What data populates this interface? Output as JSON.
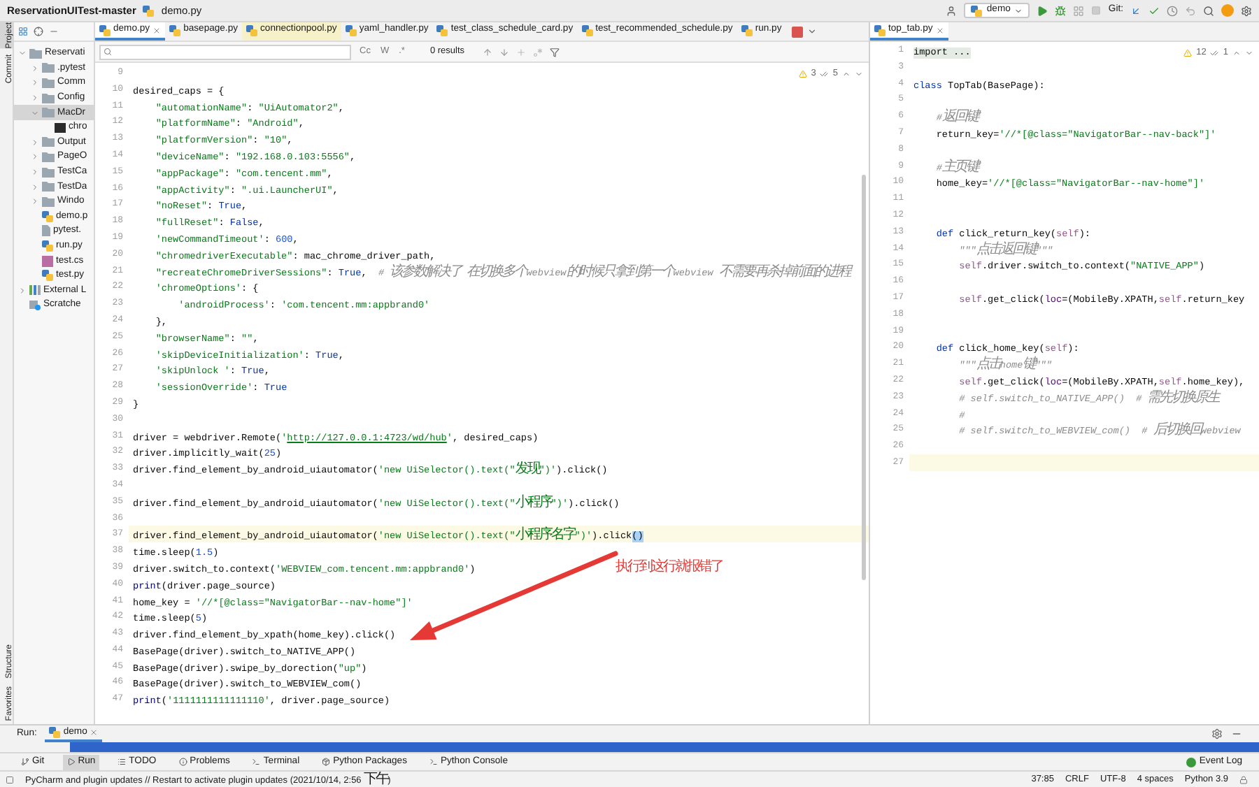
{
  "title_bar": {
    "project": "ReservationUITest-master",
    "file": "demo.py",
    "run_config": "demo",
    "vcs_label": "Git:"
  },
  "side_strip_top": [
    {
      "label": "Project",
      "selected": true
    },
    {
      "label": "Commit",
      "selected": false
    }
  ],
  "side_strip_bottom": [
    {
      "label": "Structure",
      "selected": false
    },
    {
      "label": "Favorites",
      "selected": false
    }
  ],
  "project_tree": [
    {
      "label": "Reservati",
      "kind": "folder",
      "expanded": true,
      "selected": false,
      "children": [
        {
          "label": ".pytest",
          "kind": "folder",
          "expanded": false,
          "selected": false
        },
        {
          "label": "Comm",
          "kind": "folder",
          "expanded": false,
          "selected": false
        },
        {
          "label": "Config",
          "kind": "folder",
          "expanded": false,
          "selected": false
        },
        {
          "label": "MacDr",
          "kind": "folder",
          "expanded": true,
          "selected": true,
          "children": [
            {
              "label": "chro",
              "kind": "executable",
              "selected": false
            }
          ]
        },
        {
          "label": "Output",
          "kind": "folder",
          "expanded": false,
          "selected": false
        },
        {
          "label": "PageO",
          "kind": "folder",
          "expanded": false,
          "selected": false
        },
        {
          "label": "TestCa",
          "kind": "folder",
          "expanded": false,
          "selected": false
        },
        {
          "label": "TestDa",
          "kind": "folder",
          "expanded": false,
          "selected": false
        },
        {
          "label": "Windo",
          "kind": "folder",
          "expanded": false,
          "selected": false
        },
        {
          "label": "demo.p",
          "kind": "python",
          "selected": false
        },
        {
          "label": "pytest.",
          "kind": "text",
          "selected": false
        },
        {
          "label": "run.py",
          "kind": "python",
          "selected": false
        },
        {
          "label": "test.cs",
          "kind": "csv",
          "selected": false
        },
        {
          "label": "test.py",
          "kind": "python",
          "selected": false
        }
      ]
    },
    {
      "label": "External L",
      "kind": "library",
      "expanded": false,
      "selected": false
    },
    {
      "label": "Scratche",
      "kind": "scratches",
      "selected": false
    }
  ],
  "editor_tabs": [
    {
      "label": "demo.py",
      "selected": true,
      "highlighted": false
    },
    {
      "label": "basepage.py",
      "selected": false,
      "highlighted": false
    },
    {
      "label": "connectionpool.py",
      "selected": false,
      "highlighted": true
    },
    {
      "label": "yaml_handler.py",
      "selected": false,
      "highlighted": false
    },
    {
      "label": "test_class_schedule_card.py",
      "selected": false,
      "highlighted": false
    },
    {
      "label": "test_recommended_schedule.py",
      "selected": false,
      "highlighted": false
    },
    {
      "label": "run.py",
      "selected": false,
      "highlighted": false
    }
  ],
  "right_tabs": [
    {
      "label": "top_tab.py",
      "selected": true
    }
  ],
  "find_bar": {
    "options": [
      "Cc",
      "W",
      ".*"
    ],
    "results": "0 results"
  },
  "left_editor": {
    "warnings": "3",
    "passed": "5",
    "annotation": "执行到这行就报错了",
    "lines": [
      {
        "number": "9",
        "current": false
      },
      {
        "number": "10",
        "current": false,
        "tokens": [
          {
            "text": "desired_caps = {",
            "kind": "plain"
          }
        ]
      },
      {
        "number": "11",
        "current": false,
        "tokens": [
          {
            "text": "    \"automationName\"",
            "kind": "str"
          },
          {
            "text": ": ",
            "kind": "plain"
          },
          {
            "text": "\"UiAutomator2\"",
            "kind": "str"
          },
          {
            "text": ",",
            "kind": "plain"
          }
        ]
      },
      {
        "number": "12",
        "current": false,
        "tokens": [
          {
            "text": "    \"platformName\"",
            "kind": "str"
          },
          {
            "text": ": ",
            "kind": "plain"
          },
          {
            "text": "\"Android\"",
            "kind": "str"
          },
          {
            "text": ",",
            "kind": "plain"
          }
        ]
      },
      {
        "number": "13",
        "current": false,
        "tokens": [
          {
            "text": "    \"platformVersion\"",
            "kind": "str"
          },
          {
            "text": ": ",
            "kind": "plain"
          },
          {
            "text": "\"10\"",
            "kind": "str"
          },
          {
            "text": ",",
            "kind": "plain"
          }
        ]
      },
      {
        "number": "14",
        "current": false,
        "tokens": [
          {
            "text": "    \"deviceName\"",
            "kind": "str"
          },
          {
            "text": ": ",
            "kind": "plain"
          },
          {
            "text": "\"192.168.0.103:5556\"",
            "kind": "str"
          },
          {
            "text": ",",
            "kind": "plain"
          }
        ]
      },
      {
        "number": "15",
        "current": false,
        "tokens": [
          {
            "text": "    \"appPackage\"",
            "kind": "str"
          },
          {
            "text": ": ",
            "kind": "plain"
          },
          {
            "text": "\"com.tencent.mm\"",
            "kind": "str"
          },
          {
            "text": ",",
            "kind": "plain"
          }
        ]
      },
      {
        "number": "16",
        "current": false,
        "tokens": [
          {
            "text": "    \"appActivity\"",
            "kind": "str"
          },
          {
            "text": ": ",
            "kind": "plain"
          },
          {
            "text": "\".ui.LauncherUI\"",
            "kind": "str"
          },
          {
            "text": ",",
            "kind": "plain"
          }
        ]
      },
      {
        "number": "17",
        "current": false,
        "tokens": [
          {
            "text": "    \"noReset\"",
            "kind": "str"
          },
          {
            "text": ": ",
            "kind": "plain"
          },
          {
            "text": "True",
            "kind": "kw"
          },
          {
            "text": ",",
            "kind": "plain"
          }
        ]
      },
      {
        "number": "18",
        "current": false,
        "tokens": [
          {
            "text": "    \"fullReset\"",
            "kind": "str"
          },
          {
            "text": ": ",
            "kind": "plain"
          },
          {
            "text": "False",
            "kind": "kw"
          },
          {
            "text": ",",
            "kind": "plain"
          }
        ]
      },
      {
        "number": "19",
        "current": false,
        "tokens": [
          {
            "text": "    'newCommandTimeout'",
            "kind": "str"
          },
          {
            "text": ": ",
            "kind": "plain"
          },
          {
            "text": "600",
            "kind": "num"
          },
          {
            "text": ",",
            "kind": "plain"
          }
        ]
      },
      {
        "number": "20",
        "current": false,
        "tokens": [
          {
            "text": "    \"chromedriverExecutable\"",
            "kind": "str"
          },
          {
            "text": ": mac_chrome_driver_path,",
            "kind": "plain"
          }
        ]
      },
      {
        "number": "21",
        "current": false,
        "tokens": [
          {
            "text": "    \"recreateChromeDriverSessions\"",
            "kind": "str"
          },
          {
            "text": ": ",
            "kind": "plain"
          },
          {
            "text": "True",
            "kind": "kw"
          },
          {
            "text": ",  ",
            "kind": "plain"
          },
          {
            "text": "# 该参数解决了 在切换多个webview的时候只拿到第一个webview 不需要再杀掉前面的进程",
            "kind": "com"
          }
        ]
      },
      {
        "number": "22",
        "current": false,
        "tokens": [
          {
            "text": "    'chromeOptions'",
            "kind": "str"
          },
          {
            "text": ": {",
            "kind": "plain"
          }
        ]
      },
      {
        "number": "23",
        "current": false,
        "tokens": [
          {
            "text": "        'androidProcess'",
            "kind": "str"
          },
          {
            "text": ": ",
            "kind": "plain"
          },
          {
            "text": "'com.tencent.mm:appbrand0'",
            "kind": "str"
          }
        ]
      },
      {
        "number": "24",
        "current": false,
        "tokens": [
          {
            "text": "    },",
            "kind": "plain"
          }
        ]
      },
      {
        "number": "25",
        "current": false,
        "tokens": [
          {
            "text": "    \"browserName\"",
            "kind": "str"
          },
          {
            "text": ": ",
            "kind": "plain"
          },
          {
            "text": "\"\"",
            "kind": "str"
          },
          {
            "text": ",",
            "kind": "plain"
          }
        ]
      },
      {
        "number": "26",
        "current": false,
        "tokens": [
          {
            "text": "    'skipDeviceInitialization'",
            "kind": "str"
          },
          {
            "text": ": ",
            "kind": "plain"
          },
          {
            "text": "True",
            "kind": "kw"
          },
          {
            "text": ",",
            "kind": "plain"
          }
        ]
      },
      {
        "number": "27",
        "current": false,
        "tokens": [
          {
            "text": "    'skipUnlock '",
            "kind": "str"
          },
          {
            "text": ": ",
            "kind": "plain"
          },
          {
            "text": "True",
            "kind": "kw"
          },
          {
            "text": ",",
            "kind": "plain"
          }
        ]
      },
      {
        "number": "28",
        "current": false,
        "tokens": [
          {
            "text": "    'sessionOverride'",
            "kind": "str"
          },
          {
            "text": ": ",
            "kind": "plain"
          },
          {
            "text": "True",
            "kind": "kw"
          }
        ]
      },
      {
        "number": "29",
        "current": false,
        "tokens": [
          {
            "text": "}",
            "kind": "plain"
          }
        ]
      },
      {
        "number": "30",
        "current": false
      },
      {
        "number": "31",
        "current": false,
        "tokens": [
          {
            "text": "driver = webdriver.Remote(",
            "kind": "plain"
          },
          {
            "text": "'",
            "kind": "str"
          },
          {
            "text": "http://127.0.0.1:4723/wd/hub",
            "kind": "link"
          },
          {
            "text": "'",
            "kind": "str"
          },
          {
            "text": ", desired_caps)",
            "kind": "plain"
          }
        ]
      },
      {
        "number": "32",
        "current": false,
        "tokens": [
          {
            "text": "driver.implicitly_wait(",
            "kind": "plain"
          },
          {
            "text": "25",
            "kind": "num"
          },
          {
            "text": ")",
            "kind": "plain"
          }
        ]
      },
      {
        "number": "33",
        "current": false,
        "tokens": [
          {
            "text": "driver.find_element_by_android_uiautomator(",
            "kind": "plain"
          },
          {
            "text": "'new UiSelector().text(\"发现\")'",
            "kind": "str"
          },
          {
            "text": ").click()",
            "kind": "plain"
          }
        ]
      },
      {
        "number": "34",
        "current": false
      },
      {
        "number": "35",
        "current": false,
        "tokens": [
          {
            "text": "driver.find_element_by_android_uiautomator(",
            "kind": "plain"
          },
          {
            "text": "'new UiSelector().text(\"小程序\")'",
            "kind": "str"
          },
          {
            "text": ").click()",
            "kind": "plain"
          }
        ]
      },
      {
        "number": "36",
        "current": false
      },
      {
        "number": "37",
        "current": true,
        "tokens": [
          {
            "text": "driver.find_element_by_android_uiautomator(",
            "kind": "plain"
          },
          {
            "text": "'new UiSelector().text(\"小程序名字\")'",
            "kind": "str"
          },
          {
            "text": ").click",
            "kind": "plain"
          },
          {
            "text": "()",
            "kind": "match"
          }
        ]
      },
      {
        "number": "38",
        "current": false,
        "tokens": [
          {
            "text": "time.sleep(",
            "kind": "plain"
          },
          {
            "text": "1.5",
            "kind": "num"
          },
          {
            "text": ")",
            "kind": "plain"
          }
        ]
      },
      {
        "number": "39",
        "current": false,
        "tokens": [
          {
            "text": "driver.switch_to.context(",
            "kind": "plain"
          },
          {
            "text": "'WEBVIEW_com.tencent.mm:appbrand0'",
            "kind": "str"
          },
          {
            "text": ")",
            "kind": "plain"
          }
        ]
      },
      {
        "number": "40",
        "current": false,
        "tokens": [
          {
            "text": "print",
            "kind": "builtin"
          },
          {
            "text": "(driver.page_source)",
            "kind": "plain"
          }
        ]
      },
      {
        "number": "41",
        "current": false,
        "tokens": [
          {
            "text": "home_key = ",
            "kind": "plain"
          },
          {
            "text": "'//*[@class=\"NavigatorBar--nav-home\"]'",
            "kind": "str"
          }
        ]
      },
      {
        "number": "42",
        "current": false,
        "tokens": [
          {
            "text": "time.sleep(",
            "kind": "plain"
          },
          {
            "text": "5",
            "kind": "num"
          },
          {
            "text": ")",
            "kind": "plain"
          }
        ]
      },
      {
        "number": "43",
        "current": false,
        "tokens": [
          {
            "text": "driver.find_element_by_xpath(home_key).click()",
            "kind": "plain"
          }
        ]
      },
      {
        "number": "44",
        "current": false,
        "tokens": [
          {
            "text": "BasePage(driver).switch_to_NATIVE_APP()",
            "kind": "plain"
          }
        ]
      },
      {
        "number": "45",
        "current": false,
        "tokens": [
          {
            "text": "BasePage(driver).swipe_by_dorection(",
            "kind": "plain"
          },
          {
            "text": "\"up\"",
            "kind": "str"
          },
          {
            "text": ")",
            "kind": "plain"
          }
        ]
      },
      {
        "number": "46",
        "current": false,
        "tokens": [
          {
            "text": "BasePage(driver).switch_to_WEBVIEW_com()",
            "kind": "plain"
          }
        ]
      },
      {
        "number": "47",
        "current": false,
        "tokens": [
          {
            "text": "print",
            "kind": "builtin"
          },
          {
            "text": "(",
            "kind": "plain"
          },
          {
            "text": "'1111111111111110'",
            "kind": "str"
          },
          {
            "text": ", driver.page_source)",
            "kind": "plain"
          }
        ]
      }
    ]
  },
  "right_editor": {
    "warnings": "12",
    "passed": "1",
    "lines": [
      {
        "number": "1",
        "current": false,
        "tokens": [
          {
            "text": "import ...",
            "kind": "fold"
          }
        ]
      },
      {
        "number": "3",
        "current": false
      },
      {
        "number": "4",
        "current": false,
        "tokens": [
          {
            "text": "class",
            "kind": "kw"
          },
          {
            "text": " TopTab(BasePage):",
            "kind": "plain"
          }
        ]
      },
      {
        "number": "5",
        "current": false
      },
      {
        "number": "6",
        "current": false,
        "tokens": [
          {
            "text": "    #返回键",
            "kind": "com"
          }
        ]
      },
      {
        "number": "7",
        "current": false,
        "tokens": [
          {
            "text": "    return_key=",
            "kind": "plain"
          },
          {
            "text": "'//*[@class=\"NavigatorBar--nav-back\"]'",
            "kind": "str"
          }
        ]
      },
      {
        "number": "8",
        "current": false
      },
      {
        "number": "9",
        "current": false,
        "tokens": [
          {
            "text": "    #主页键",
            "kind": "com"
          }
        ]
      },
      {
        "number": "10",
        "current": false,
        "tokens": [
          {
            "text": "    home_key=",
            "kind": "plain"
          },
          {
            "text": "'//*[@class=\"NavigatorBar--nav-home\"]'",
            "kind": "str"
          }
        ]
      },
      {
        "number": "11",
        "current": false
      },
      {
        "number": "12",
        "current": false
      },
      {
        "number": "13",
        "current": false,
        "tokens": [
          {
            "text": "    def",
            "kind": "kw"
          },
          {
            "text": " click_return_key(",
            "kind": "plain"
          },
          {
            "text": "self",
            "kind": "self"
          },
          {
            "text": "):",
            "kind": "plain"
          }
        ]
      },
      {
        "number": "14",
        "current": false,
        "tokens": [
          {
            "text": "        \"\"\"点击返回键\"\"\"",
            "kind": "doc"
          }
        ]
      },
      {
        "number": "15",
        "current": false,
        "tokens": [
          {
            "text": "        self",
            "kind": "self"
          },
          {
            "text": ".driver.switch_to.context(",
            "kind": "plain"
          },
          {
            "text": "\"NATIVE_APP\"",
            "kind": "str"
          },
          {
            "text": ")",
            "kind": "plain"
          }
        ]
      },
      {
        "number": "16",
        "current": false
      },
      {
        "number": "17",
        "current": false,
        "tokens": [
          {
            "text": "        self",
            "kind": "self"
          },
          {
            "text": ".get_click(",
            "kind": "plain"
          },
          {
            "text": "loc",
            "kind": "kwarg"
          },
          {
            "text": "=(MobileBy.XPATH,",
            "kind": "plain"
          },
          {
            "text": "self",
            "kind": "self"
          },
          {
            "text": ".return_key",
            "kind": "plain"
          }
        ]
      },
      {
        "number": "18",
        "current": false
      },
      {
        "number": "19",
        "current": false
      },
      {
        "number": "20",
        "current": false,
        "tokens": [
          {
            "text": "    def",
            "kind": "kw"
          },
          {
            "text": " click_home_key(",
            "kind": "plain"
          },
          {
            "text": "self",
            "kind": "self"
          },
          {
            "text": "):",
            "kind": "plain"
          }
        ]
      },
      {
        "number": "21",
        "current": false,
        "tokens": [
          {
            "text": "        \"\"\"点击home键\"\"\"",
            "kind": "doc"
          }
        ]
      },
      {
        "number": "22",
        "current": false,
        "tokens": [
          {
            "text": "        self",
            "kind": "self"
          },
          {
            "text": ".get_click(",
            "kind": "plain"
          },
          {
            "text": "loc",
            "kind": "kwarg"
          },
          {
            "text": "=(MobileBy.XPATH,",
            "kind": "plain"
          },
          {
            "text": "self",
            "kind": "self"
          },
          {
            "text": ".home_key),",
            "kind": "plain"
          }
        ]
      },
      {
        "number": "23",
        "current": false,
        "tokens": [
          {
            "text": "        # self.switch_to_NATIVE_APP()  # 需先切换原生",
            "kind": "com"
          }
        ]
      },
      {
        "number": "24",
        "current": false,
        "tokens": [
          {
            "text": "        #",
            "kind": "com"
          }
        ]
      },
      {
        "number": "25",
        "current": false,
        "tokens": [
          {
            "text": "        # self.switch_to_WEBVIEW_com()  # 后切换回webview",
            "kind": "com"
          }
        ]
      },
      {
        "number": "26",
        "current": false
      },
      {
        "number": "27",
        "current": true
      }
    ]
  },
  "run_panel": {
    "label": "Run:",
    "tabs": [
      {
        "label": "demo",
        "selected": true
      }
    ]
  },
  "tool_windows": [
    {
      "label": "Git",
      "selected": false
    },
    {
      "label": "Run",
      "selected": true
    },
    {
      "label": "TODO",
      "selected": false
    },
    {
      "label": "Problems",
      "selected": false
    },
    {
      "label": "Terminal",
      "selected": false
    },
    {
      "label": "Python Packages",
      "selected": false
    },
    {
      "label": "Python Console",
      "selected": false
    }
  ],
  "event_log": "Event Log",
  "status_bar": {
    "message": "PyCharm and plugin updates // Restart to activate plugin updates (2021/10/14, 2:56 下午)",
    "items": [
      "37:85",
      "CRLF",
      "UTF-8",
      "4 spaces",
      "Python 3.9"
    ]
  }
}
